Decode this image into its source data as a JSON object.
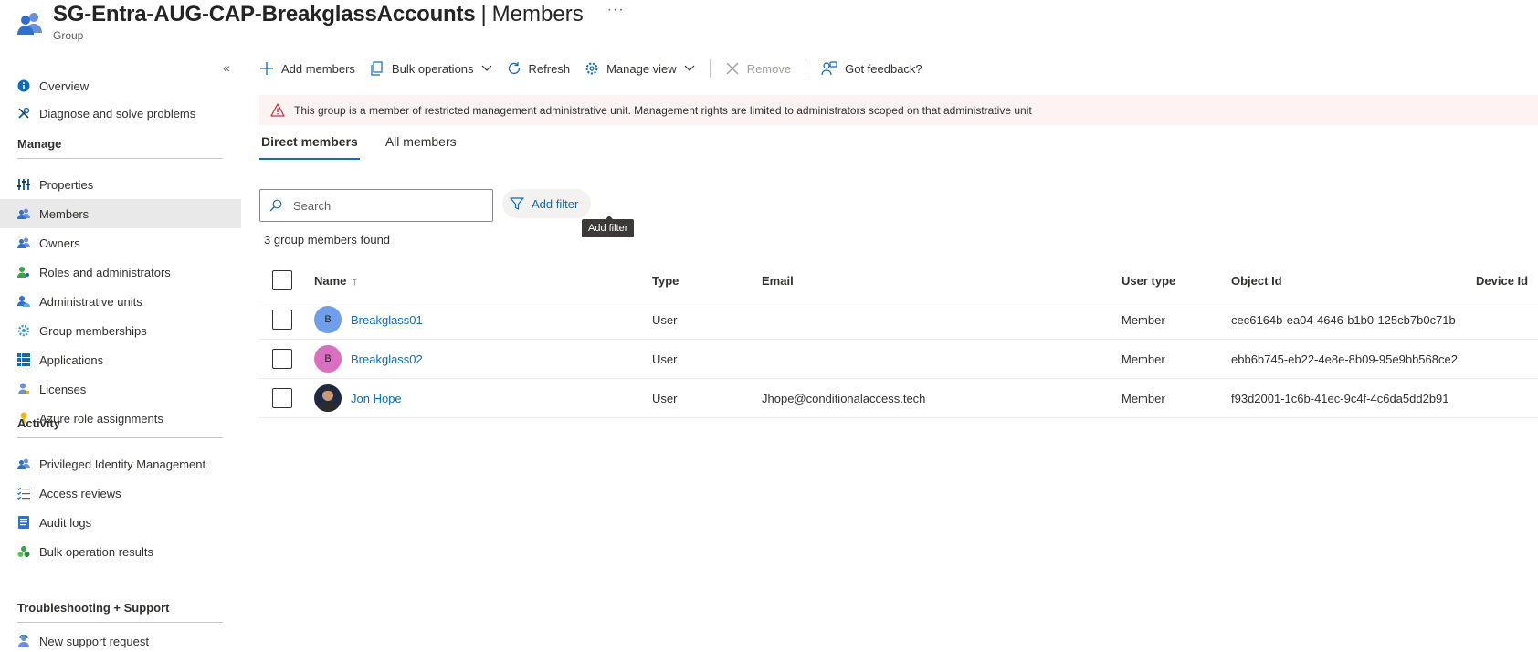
{
  "header": {
    "title": "SG-Entra-AUG-CAP-BreakglassAccounts",
    "separator": "|",
    "section": "Members",
    "more": "···",
    "subtitle": "Group"
  },
  "sidebar": {
    "collapse_glyph": "«",
    "items_top": [
      {
        "label": "Overview",
        "icon": "info-icon"
      },
      {
        "label": "Diagnose and solve problems",
        "icon": "wrench-icon"
      }
    ],
    "manage_heading": "Manage",
    "manage_items": [
      {
        "label": "Properties",
        "icon": "sliders-icon"
      },
      {
        "label": "Members",
        "icon": "people-icon",
        "active": true
      },
      {
        "label": "Owners",
        "icon": "people-icon"
      },
      {
        "label": "Roles and administrators",
        "icon": "person-key-icon"
      },
      {
        "label": "Administrative units",
        "icon": "admin-units-icon"
      },
      {
        "label": "Group memberships",
        "icon": "gear-icon"
      },
      {
        "label": "Applications",
        "icon": "grid-icon"
      },
      {
        "label": "Licenses",
        "icon": "person-license-icon"
      },
      {
        "label": "Azure role assignments",
        "icon": "key-icon"
      }
    ],
    "activity_heading": "Activity",
    "activity_items": [
      {
        "label": "Privileged Identity Management",
        "icon": "people-icon"
      },
      {
        "label": "Access reviews",
        "icon": "checklist-icon"
      },
      {
        "label": "Audit logs",
        "icon": "log-icon"
      },
      {
        "label": "Bulk operation results",
        "icon": "bulk-results-icon"
      }
    ],
    "support_heading": "Troubleshooting + Support",
    "support_items": [
      {
        "label": "New support request",
        "icon": "support-person-icon"
      }
    ]
  },
  "toolbar": {
    "add_members": "Add members",
    "bulk_operations": "Bulk operations",
    "refresh": "Refresh",
    "manage_view": "Manage view",
    "remove": "Remove",
    "feedback": "Got feedback?"
  },
  "banner": {
    "text": "This group is a member of restricted management administrative unit. Management rights are limited to administrators scoped on that administrative unit"
  },
  "tabs": [
    {
      "label": "Direct members",
      "active": true
    },
    {
      "label": "All members",
      "active": false
    }
  ],
  "search": {
    "placeholder": "Search",
    "value": ""
  },
  "filter": {
    "label": "Add filter",
    "tooltip": "Add filter"
  },
  "count_text": "3 group members found",
  "table": {
    "columns": [
      "Name",
      "Type",
      "Email",
      "User type",
      "Object Id",
      "Device Id"
    ],
    "sort_indicator": "↑",
    "rows": [
      {
        "initial": "B",
        "avatar_color": "#6f9fea",
        "name": "Breakglass01",
        "type": "User",
        "email": "",
        "user_type": "Member",
        "object_id": "cec6164b-ea04-4646-b1b0-125cb7b0c71b",
        "device_id": ""
      },
      {
        "initial": "B",
        "avatar_color": "#d96fc0",
        "name": "Breakglass02",
        "type": "User",
        "email": "",
        "user_type": "Member",
        "object_id": "ebb6b745-eb22-4e8e-8b09-95e9bb568ce2",
        "device_id": ""
      },
      {
        "initial": "",
        "avatar_color": "#1e2a44",
        "name": "Jon Hope",
        "type": "User",
        "email": "Jhope@conditionalaccess.tech",
        "user_type": "Member",
        "object_id": "f93d2001-1c6b-41ec-9c4f-4c6da5dd2b91",
        "device_id": ""
      }
    ]
  },
  "colors": {
    "accent": "#0f6cbd",
    "banner_bg": "#fdf3f2",
    "warning": "#c4314b",
    "active_nav": "#e9e9e9"
  }
}
